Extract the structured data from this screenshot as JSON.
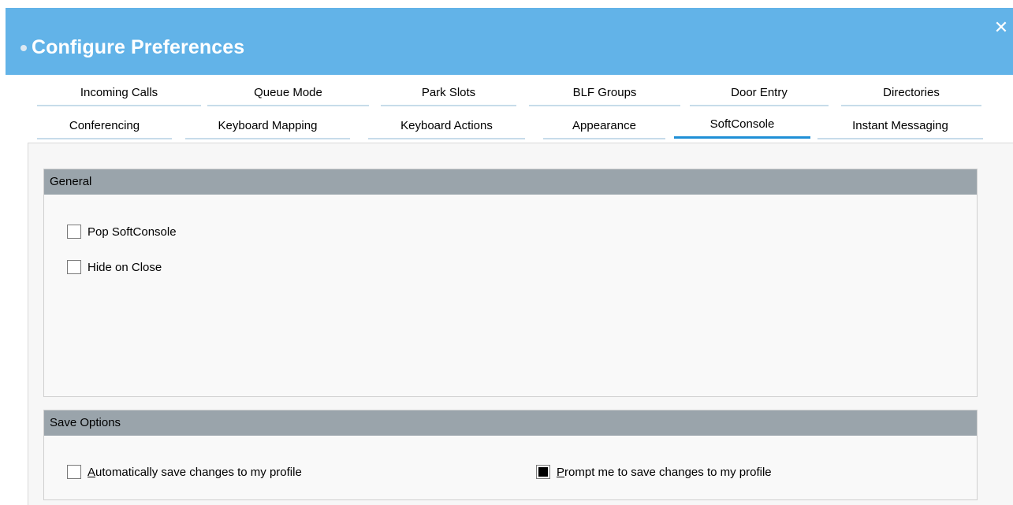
{
  "window": {
    "title": "Configure Preferences",
    "close_icon": "close-icon"
  },
  "tabs_row1": [
    {
      "label": "Incoming Calls"
    },
    {
      "label": "Queue Mode"
    },
    {
      "label": "Park Slots"
    },
    {
      "label": "BLF Groups"
    },
    {
      "label": "Door Entry"
    },
    {
      "label": "Directories"
    }
  ],
  "tabs_row2": [
    {
      "label": "Conferencing"
    },
    {
      "label": "Keyboard Mapping"
    },
    {
      "label": "Keyboard Actions"
    },
    {
      "label": "Appearance"
    },
    {
      "label": "SoftConsole",
      "active": true
    },
    {
      "label": "Instant Messaging"
    }
  ],
  "general": {
    "header": "General",
    "options": [
      {
        "label": "Pop SoftConsole",
        "checked": false
      },
      {
        "label": "Hide on Close",
        "checked": false
      }
    ]
  },
  "save_options": {
    "header": "Save Options",
    "auto_save": {
      "access_key": "A",
      "label_rest": "utomatically save changes to my profile",
      "checked": false
    },
    "prompt_save": {
      "access_key": "P",
      "label_rest": "rompt me to save changes to my profile",
      "checked": true
    }
  },
  "colors": {
    "title_bar": "#62b3e8",
    "section_header": "#9aa4ab",
    "active_tab_underline": "#1f8fd6"
  }
}
